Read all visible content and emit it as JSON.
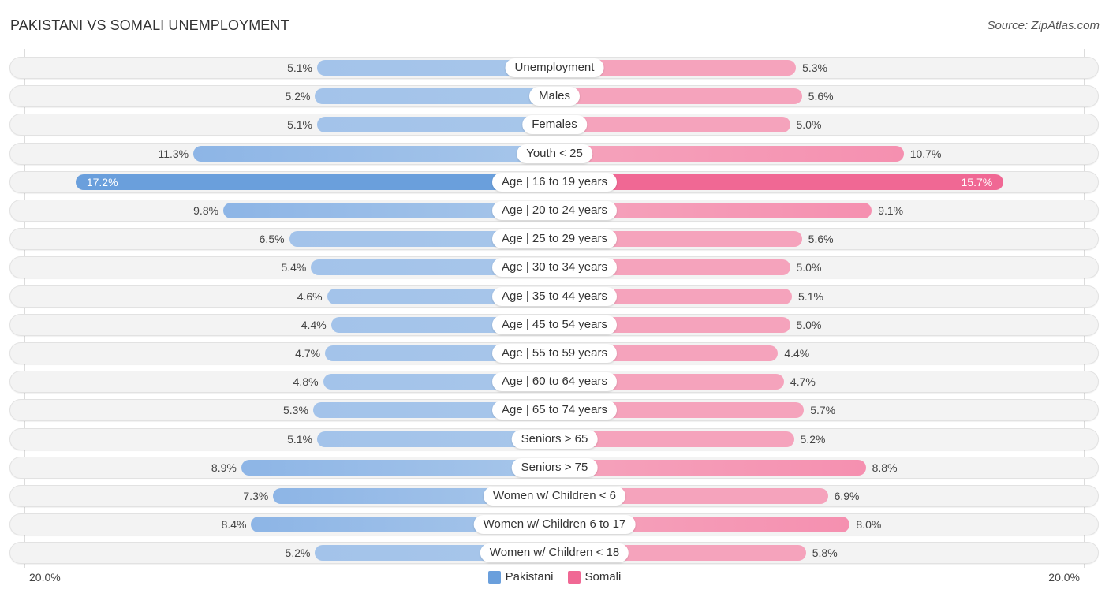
{
  "header": {
    "title": "PAKISTANI VS SOMALI UNEMPLOYMENT",
    "source": "Source: ZipAtlas.com"
  },
  "colors": {
    "pakistani": "#a7c6ea",
    "pakistani_strong": "#6a9fdc",
    "somali": "#f5a3bc",
    "somali_strong": "#f06894"
  },
  "chart_data": {
    "type": "bar",
    "orientation": "horizontal-diverging",
    "title": "PAKISTANI VS SOMALI UNEMPLOYMENT",
    "xlabel": "",
    "ylabel": "",
    "axis_min_label": "20.0%",
    "axis_max_label": "20.0%",
    "xlim": [
      -20,
      20
    ],
    "legend_position": "bottom-center",
    "categories": [
      "Unemployment",
      "Males",
      "Females",
      "Youth < 25",
      "Age | 16 to 19 years",
      "Age | 20 to 24 years",
      "Age | 25 to 29 years",
      "Age | 30 to 34 years",
      "Age | 35 to 44 years",
      "Age | 45 to 54 years",
      "Age | 55 to 59 years",
      "Age | 60 to 64 years",
      "Age | 65 to 74 years",
      "Seniors > 65",
      "Seniors > 75",
      "Women w/ Children < 6",
      "Women w/ Children 6 to 17",
      "Women w/ Children < 18"
    ],
    "series": [
      {
        "name": "Pakistani",
        "side": "left",
        "values": [
          5.1,
          5.2,
          5.1,
          11.3,
          17.2,
          9.8,
          6.5,
          5.4,
          4.6,
          4.4,
          4.7,
          4.8,
          5.3,
          5.1,
          8.9,
          7.3,
          8.4,
          5.2
        ],
        "labels": [
          "5.1%",
          "5.2%",
          "5.1%",
          "11.3%",
          "17.2%",
          "9.8%",
          "6.5%",
          "5.4%",
          "4.6%",
          "4.4%",
          "4.7%",
          "4.8%",
          "5.3%",
          "5.1%",
          "8.9%",
          "7.3%",
          "8.4%",
          "5.2%"
        ]
      },
      {
        "name": "Somali",
        "side": "right",
        "values": [
          5.3,
          5.6,
          5.0,
          10.7,
          15.7,
          9.1,
          5.6,
          5.0,
          5.1,
          5.0,
          4.4,
          4.7,
          5.7,
          5.2,
          8.8,
          6.9,
          8.0,
          5.8
        ],
        "labels": [
          "5.3%",
          "5.6%",
          "5.0%",
          "10.7%",
          "15.7%",
          "9.1%",
          "5.6%",
          "5.0%",
          "5.1%",
          "5.0%",
          "4.4%",
          "4.7%",
          "5.7%",
          "5.2%",
          "8.8%",
          "6.9%",
          "8.0%",
          "5.8%"
        ]
      }
    ]
  }
}
